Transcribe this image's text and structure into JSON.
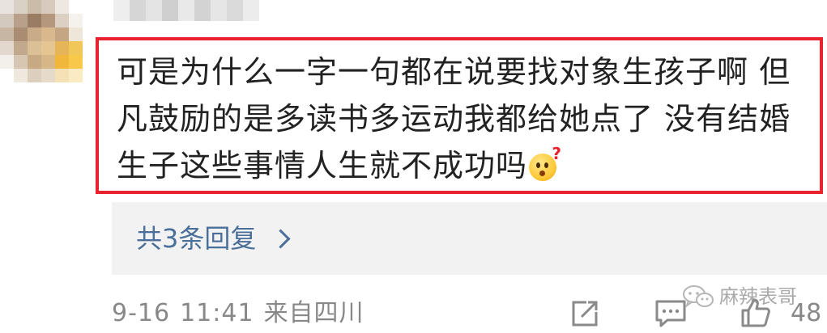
{
  "comment": {
    "lines": [
      "可是为什么一字一句都在说要找对象生孩子啊 但",
      "凡鼓励的是多读书多运动我都给她点了 没有结婚",
      "生子这些事情人生就不成功吗"
    ],
    "emoji": "thinking-question-emoji"
  },
  "replies": {
    "label": "共3条回复"
  },
  "footer": {
    "date": "9-16",
    "time": "11:41",
    "location": "来自四川",
    "like_count": "48"
  },
  "watermark": {
    "text": "麻辣表哥"
  },
  "colors": {
    "highlight_border": "#e8232e",
    "link": "#4a6f9a",
    "meta_text": "#888888",
    "panel_bg": "#f2f2f2"
  },
  "icons": [
    "share-icon",
    "comment-icon",
    "like-icon",
    "chevron-right-icon",
    "wechat-logo-icon"
  ]
}
